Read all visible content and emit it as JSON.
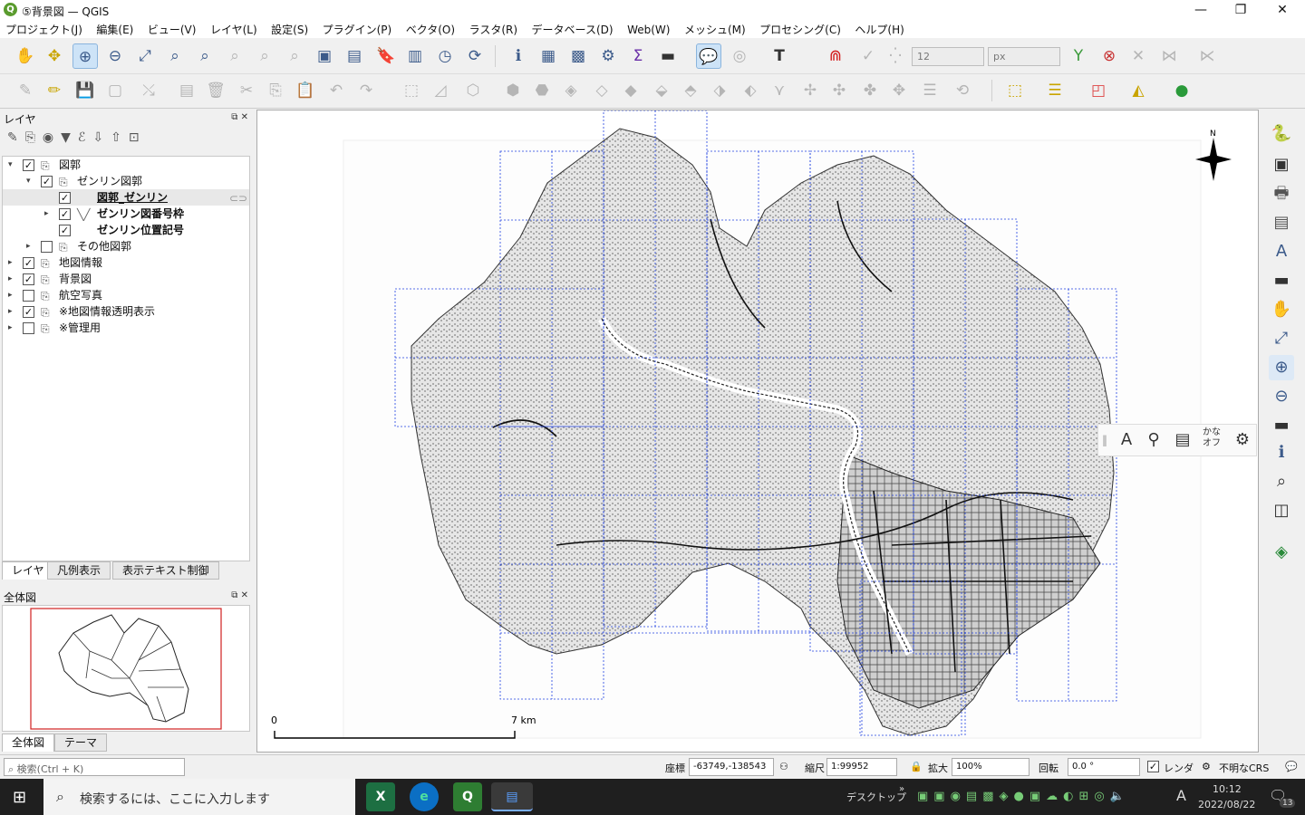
{
  "window": {
    "title": "⑤背景図 — QGIS",
    "app_icon": "Q",
    "controls": {
      "minimize": "—",
      "restore": "❐",
      "close": "✕"
    }
  },
  "menu": [
    "プロジェクト(J)",
    "編集(E)",
    "ビュー(V)",
    "レイヤ(L)",
    "設定(S)",
    "プラグイン(P)",
    "ベクタ(O)",
    "ラスタ(R)",
    "データベース(D)",
    "Web(W)",
    "メッシュ(M)",
    "プロセシング(C)",
    "ヘルプ(H)"
  ],
  "toolbar": {
    "symbol_size_value": "12",
    "symbol_unit": "px",
    "label_tool": "T"
  },
  "layers_panel": {
    "title": "レイヤ",
    "items": [
      {
        "label": "図郭",
        "checked": true,
        "expanded": true
      },
      {
        "label": "ゼンリン図郭",
        "checked": true,
        "expanded": true
      },
      {
        "label": "図郭_ゼンリン",
        "checked": true
      },
      {
        "label": "ゼンリン図番号枠",
        "checked": true
      },
      {
        "label": "ゼンリン位置記号",
        "checked": true
      },
      {
        "label": "その他図郭",
        "checked": false
      },
      {
        "label": "地図情報",
        "checked": true
      },
      {
        "label": "背景図",
        "checked": true
      },
      {
        "label": "航空写真",
        "checked": false
      },
      {
        "label": "※地図情報透明表示",
        "checked": true
      },
      {
        "label": "※管理用",
        "checked": false
      }
    ],
    "tabs": [
      "レイヤ",
      "凡例表示",
      "表示テキスト制御"
    ]
  },
  "overview_panel": {
    "title": "全体図",
    "tabs": [
      "全体図",
      "テーマ"
    ]
  },
  "map": {
    "north_label": "N",
    "scalebar_start": "0",
    "scalebar_end": "7 km"
  },
  "float_toolbar": {
    "kana_label_top": "かな",
    "kana_label_bottom": "オフ"
  },
  "statusbar": {
    "search_placeholder": "検索(Ctrl + K)",
    "coordinate_label": "座標",
    "coordinate_value": "-63749,-138543",
    "scale_label": "縮尺",
    "scale_value": "1:99952",
    "magnifier_label": "拡大",
    "magnifier_value": "100%",
    "rotation_label": "回転",
    "rotation_value": "0.0 °",
    "render_label": "レンダ",
    "crs_label": "不明なCRS"
  },
  "taskbar": {
    "search_text": "検索するには、ここに入力します",
    "desktop_label": "デスクトップ",
    "ime_label": "A",
    "time": "10:12",
    "date": "2022/08/22",
    "notification_count": "13"
  }
}
